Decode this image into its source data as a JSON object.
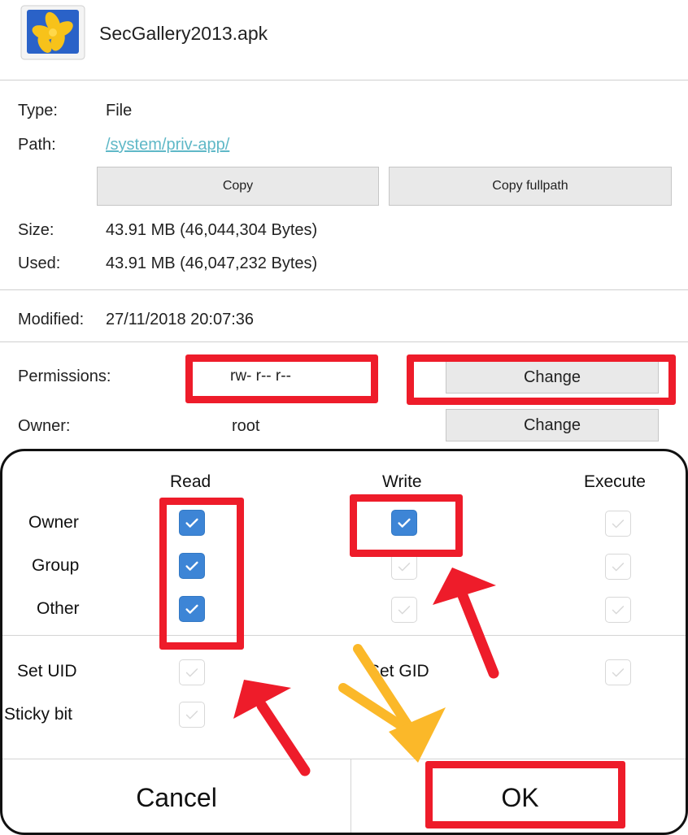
{
  "file": {
    "name": "SecGallery2013.apk",
    "icon": "gallery-flower-icon"
  },
  "details": {
    "type_label": "Type:",
    "type_value": "File",
    "path_label": "Path:",
    "path_value": "/system/priv-app/",
    "copy_label": "Copy",
    "copy_fullpath_label": "Copy fullpath",
    "size_label": "Size:",
    "size_value": "43.91 MB (46,044,304 Bytes)",
    "used_label": "Used:",
    "used_value": "43.91 MB (46,047,232 Bytes)",
    "modified_label": "Modified:",
    "modified_value": "27/11/2018 20:07:36",
    "permissions_label": "Permissions:",
    "permissions_value": "rw- r-- r--",
    "owner_label": "Owner:",
    "owner_value": "root",
    "change_label": "Change"
  },
  "dialog": {
    "columns": [
      "Read",
      "Write",
      "Execute"
    ],
    "rows": [
      {
        "label": "Owner",
        "read": true,
        "write": true,
        "execute": false
      },
      {
        "label": "Group",
        "read": true,
        "write": false,
        "execute": false
      },
      {
        "label": "Other",
        "read": true,
        "write": false,
        "execute": false
      }
    ],
    "set_uid_label": "Set UID",
    "set_gid_label": "Set GID",
    "sticky_bit_label": "Sticky bit",
    "cancel_label": "Cancel",
    "ok_label": "OK"
  },
  "colors": {
    "annotation_red": "#ee1c2a",
    "annotation_yellow": "#fbb829",
    "checkbox_blue": "#3d85d6",
    "link": "#5fb8c7"
  }
}
